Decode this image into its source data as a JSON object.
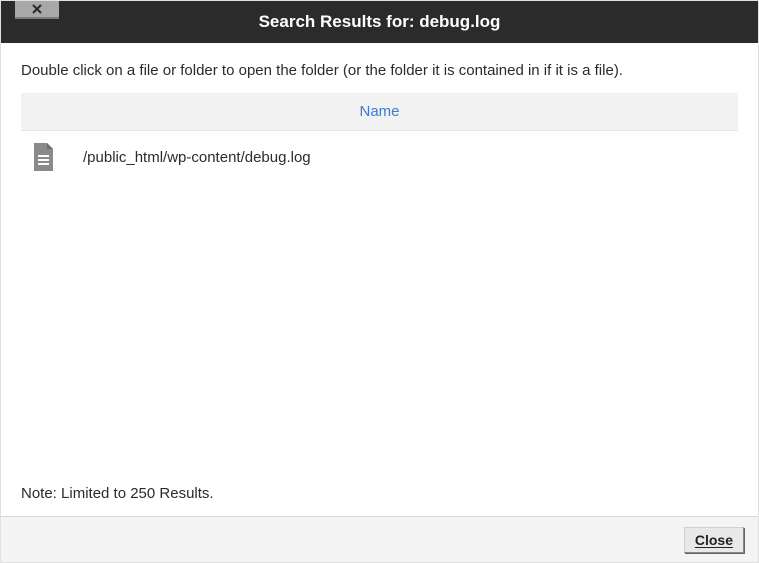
{
  "titlebar": {
    "title": "Search Results for: debug.log"
  },
  "content": {
    "instruction": "Double click on a file or folder to open the folder (or the folder it is contained in if it is a file).",
    "table": {
      "header_label": "Name",
      "rows": [
        {
          "path": "/public_html/wp-content/debug.log"
        }
      ]
    },
    "note": "Note: Limited to 250 Results."
  },
  "footer": {
    "close_label": "Close"
  }
}
